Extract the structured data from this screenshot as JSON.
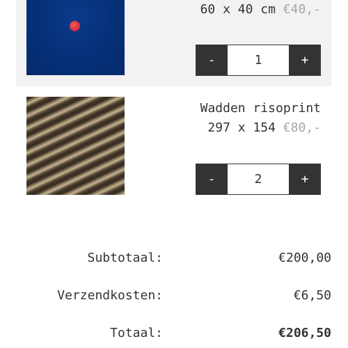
{
  "items": [
    {
      "image_icon": "lunar-eclipse-photo",
      "title": "",
      "size": "60 x 40 cm",
      "price": "€40,-",
      "quantity": "1",
      "minus_label": "-",
      "plus_label": "+"
    },
    {
      "image_icon": "sand-ripples-photo",
      "title": "Wadden risoprint",
      "size": "297 x 154",
      "price": "€80,-",
      "quantity": "2",
      "minus_label": "-",
      "plus_label": "+"
    }
  ],
  "totals": {
    "subtotal_label": "Subtotaal:",
    "subtotal_value": "€200,00",
    "shipping_label": "Verzendkosten:",
    "shipping_value": "€6,50",
    "total_label": "Totaal:",
    "total_value": "€206,50"
  },
  "colors": {
    "button_bg": "#333333",
    "price_muted": "#a6a6a6",
    "row_highlight": "#f2f2f2"
  }
}
